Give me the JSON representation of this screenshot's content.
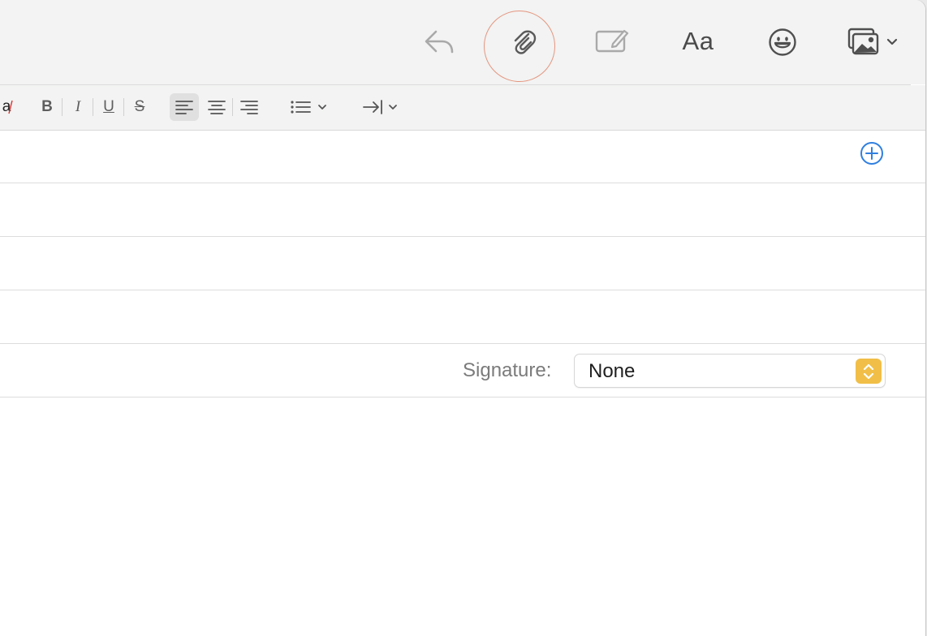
{
  "toolbar": {
    "reply_icon": "reply-arrow-icon",
    "attach_icon": "paperclip-icon",
    "markup_icon": "markup-pencil-icon",
    "font_label": "Aa",
    "emoji_icon": "smiley-icon",
    "photo_icon": "photo-browser-icon",
    "photo_menu_icon": "chevron-down-icon",
    "highlight_color": "#e5957f"
  },
  "format_bar": {
    "cut_label": "a",
    "bold": "B",
    "italic": "I",
    "underline": "U",
    "strike": "S"
  },
  "header": {
    "add_icon": "plus-circle-icon",
    "accent": "#2f7fe0"
  },
  "signature": {
    "label": "Signature:",
    "value": "None",
    "stepper_color": "#f1bf47"
  }
}
